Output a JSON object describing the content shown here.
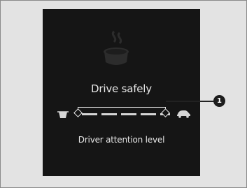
{
  "display": {
    "title": "Drive safely",
    "caption": "Driver attention level",
    "segments_count": 5
  },
  "callout": {
    "number": "1"
  },
  "icons": {
    "top": "coffee-cup-icon",
    "left": "cup-icon",
    "right": "car-icon"
  },
  "colors": {
    "background": "#e3e3e3",
    "screen": "#151515",
    "text": "#e6e6e6",
    "callout": "#1d1d1d"
  }
}
